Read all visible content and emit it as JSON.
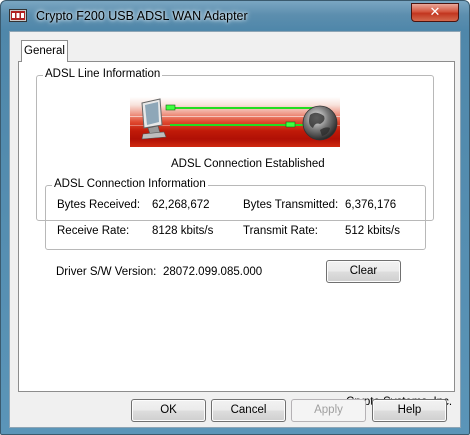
{
  "window": {
    "title": "Crypto F200 USB ADSL WAN Adapter",
    "close_glyph": "✕",
    "icon": "network-adapter-icon"
  },
  "tabs": [
    {
      "label": "General",
      "selected": true
    }
  ],
  "line_info": {
    "group_label": "ADSL Line Information",
    "status": "ADSL Connection Established",
    "graphic": "monitor-to-globe-connection-icon"
  },
  "connection_info": {
    "group_label": "ADSL Connection Information",
    "bytes_received_label": "Bytes Received:",
    "bytes_received_value": "62,268,672",
    "bytes_transmitted_label": "Bytes Transmitted:",
    "bytes_transmitted_value": "6,376,176",
    "receive_rate_label": "Receive Rate:",
    "receive_rate_value": "8128 kbits/s",
    "transmit_rate_label": "Transmit Rate:",
    "transmit_rate_value": "512 kbits/s"
  },
  "driver": {
    "label": "Driver S/W Version:",
    "version": "28072.099.085.000",
    "clear_label": "Clear"
  },
  "company": "Crypto Systems, Inc.",
  "buttons": {
    "ok": "OK",
    "cancel": "Cancel",
    "apply": "Apply",
    "help": "Help"
  },
  "colors": {
    "link_green": "#22dd22",
    "banner_red": "#cc1a0a",
    "title_bar": "#5c8eae"
  }
}
